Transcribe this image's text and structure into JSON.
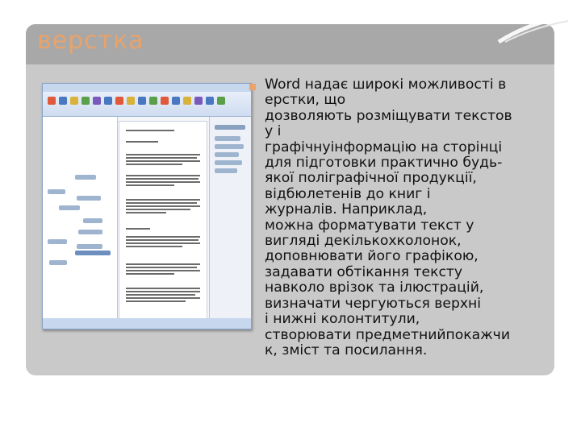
{
  "slide": {
    "title": "верстка",
    "body_lines": [
      "Word надає широкі можливості в",
      "ерстки, що",
      "дозволяють розміщувати текстов",
      "у і",
      "графічнуінформацію на сторінці",
      "для підготовки практично будь-",
      "якої поліграфічної продукції,",
      "відбюлетенів до книг і",
      "журналів. Наприклад,",
      "можна форматувати текст у",
      "вигляді декількохколонок,",
      "доповнювати його графікою,",
      "задавати обтікання тексту",
      "навколо врізок та ілюстрацій,",
      "визначати чергуються верхні",
      "і нижні колонтитули,",
      "створювати предметнийпокажчи",
      "к, зміст та посилання."
    ]
  },
  "colors": {
    "title": "#e8a36c",
    "panel": "#c9c9c9",
    "bullet": "#e8a36c"
  },
  "icons": {
    "bullet": "square-bullet-icon"
  }
}
